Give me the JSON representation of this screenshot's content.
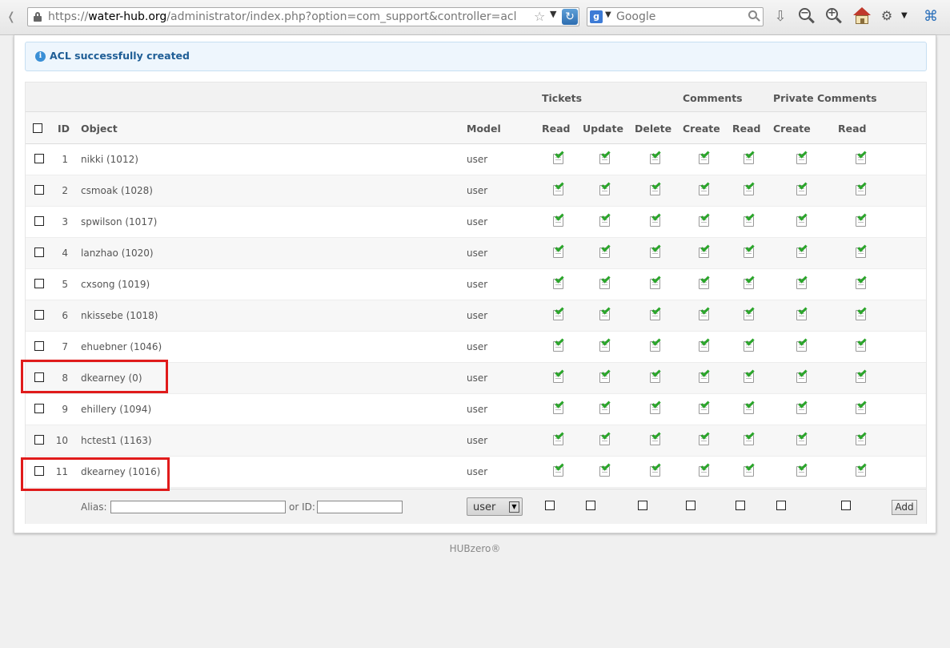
{
  "browser": {
    "url_prefix": "https://",
    "url_host": "water-hub.org",
    "url_path": "/administrator/index.php?option=com_support&controller=acl",
    "search_placeholder": "Google"
  },
  "notice": {
    "text": "ACL successfully created",
    "icon": "info-icon"
  },
  "table": {
    "groups": {
      "tickets": "Tickets",
      "comments": "Comments",
      "private_comments": "Private Comments"
    },
    "columns": {
      "id": "ID",
      "object": "Object",
      "model": "Model",
      "tickets_read": "Read",
      "tickets_update": "Update",
      "tickets_delete": "Delete",
      "comments_create": "Create",
      "comments_read": "Read",
      "private_create": "Create",
      "private_read": "Read"
    },
    "rows": [
      {
        "id": "1",
        "object": "nikki (1012)",
        "model": "user"
      },
      {
        "id": "2",
        "object": "csmoak (1028)",
        "model": "user"
      },
      {
        "id": "3",
        "object": "spwilson (1017)",
        "model": "user"
      },
      {
        "id": "4",
        "object": "lanzhao (1020)",
        "model": "user"
      },
      {
        "id": "5",
        "object": "cxsong (1019)",
        "model": "user"
      },
      {
        "id": "6",
        "object": "nkissebe (1018)",
        "model": "user"
      },
      {
        "id": "7",
        "object": "ehuebner (1046)",
        "model": "user"
      },
      {
        "id": "8",
        "object": "dkearney (0)",
        "model": "user"
      },
      {
        "id": "9",
        "object": "ehillery (1094)",
        "model": "user"
      },
      {
        "id": "10",
        "object": "hctest1 (1163)",
        "model": "user"
      },
      {
        "id": "11",
        "object": "dkearney (1016)",
        "model": "user"
      }
    ],
    "permission_icon": "checked-document-icon"
  },
  "add_form": {
    "alias_label": "Alias:",
    "alias_value": "",
    "or_id_label": "or ID:",
    "id_value": "",
    "model_selected": "user",
    "add_label": "Add"
  },
  "footer": {
    "text": "HUBzero®"
  },
  "colors": {
    "highlight": "#e01b1b",
    "notice_text": "#1f5e96",
    "check_green": "#2aa52a"
  }
}
